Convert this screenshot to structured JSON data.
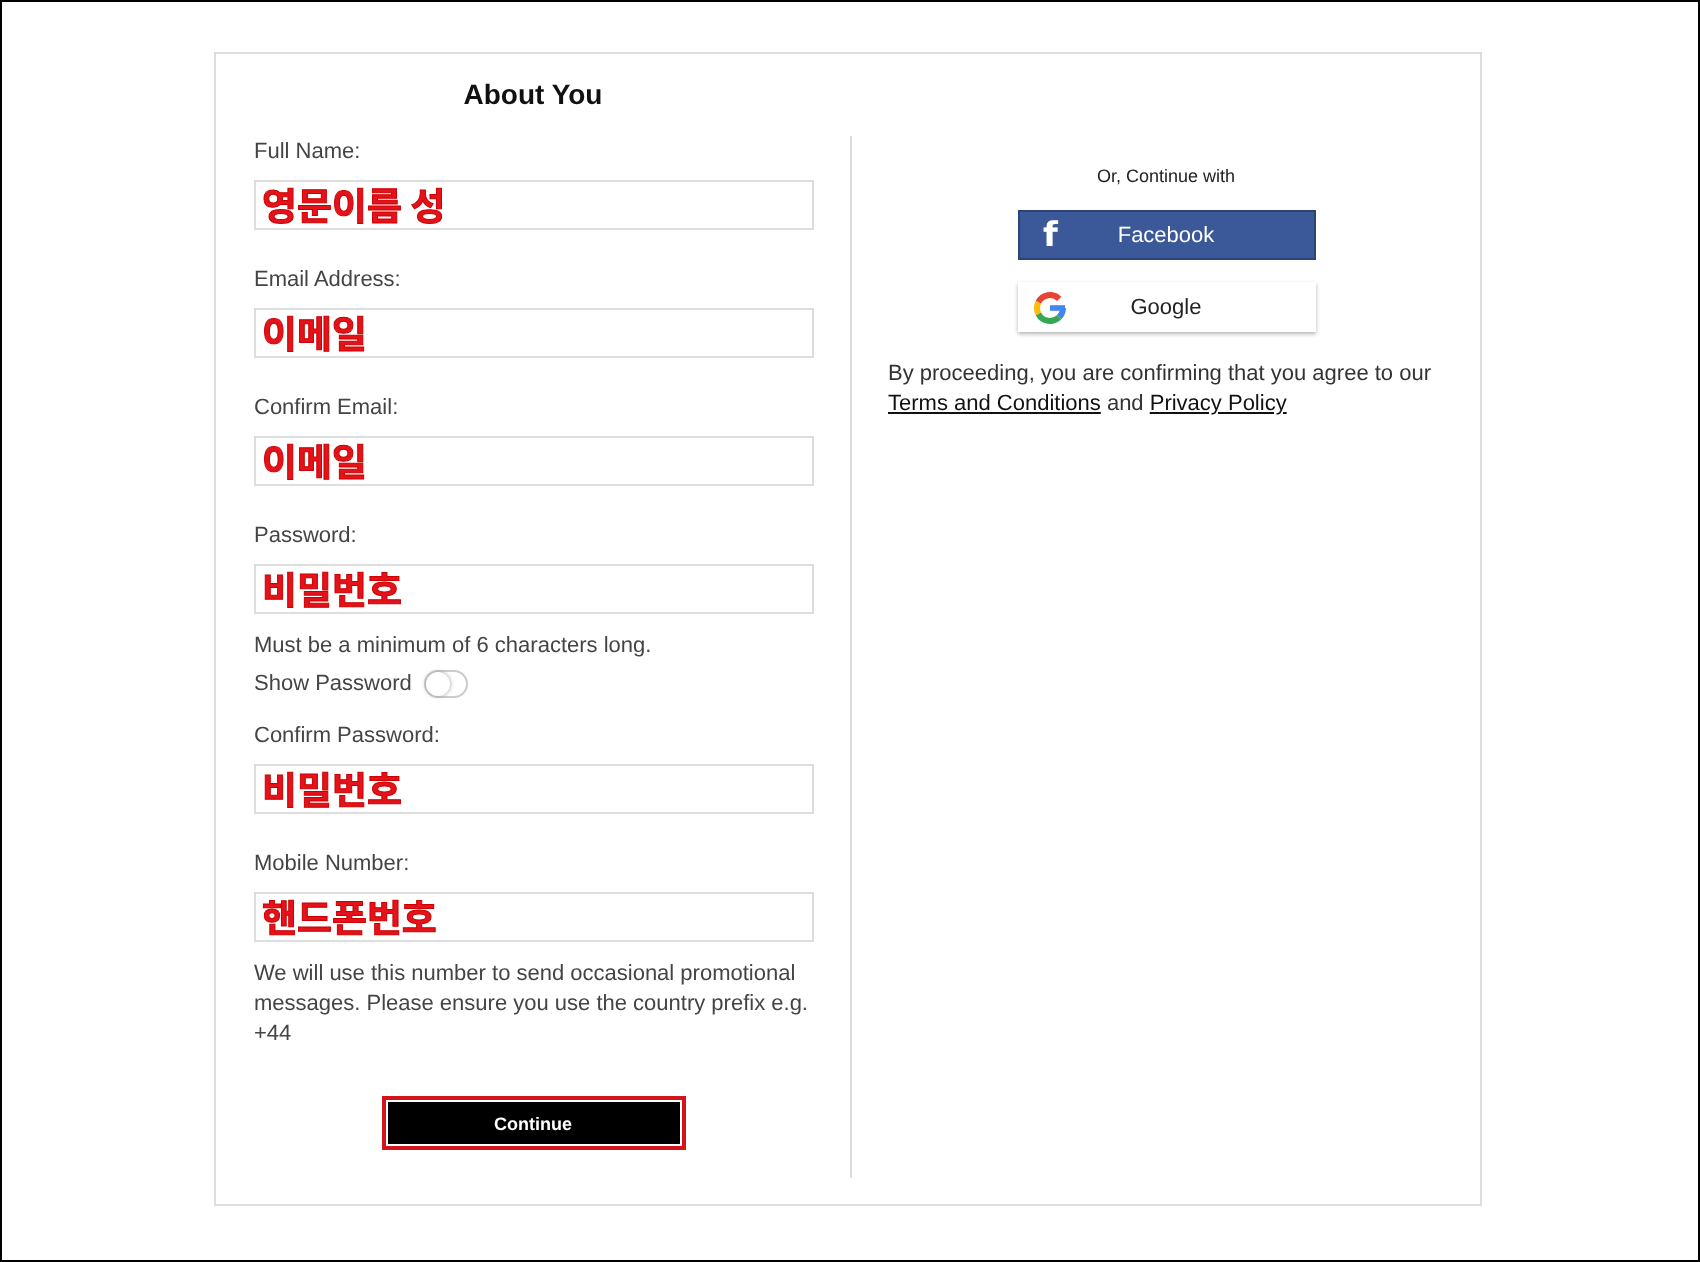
{
  "title": "About You",
  "fields": [
    {
      "label": "Full Name:",
      "value": "영문이름 성"
    },
    {
      "label": "Email Address:",
      "value": "이메일"
    },
    {
      "label": "Confirm Email:",
      "value": "이메일"
    },
    {
      "label": "Password:",
      "value": "비밀번호",
      "hint": "Must be a minimum of 6 characters long.",
      "toggle": {
        "label": "Show Password",
        "on": false
      }
    },
    {
      "label": "Confirm Password:",
      "value": "비밀번호"
    },
    {
      "label": "Mobile Number:",
      "value": "핸드폰번호",
      "hint": "We will use this number to send occasional promotional messages. Please ensure you use the country prefix e.g. +44"
    }
  ],
  "submit": {
    "label": "Continue",
    "highlighted": true
  },
  "social": {
    "heading": "Or, Continue with",
    "buttons": [
      {
        "kind": "facebook",
        "label": "Facebook",
        "icon": "f"
      },
      {
        "kind": "google",
        "label": "Google"
      }
    ]
  },
  "legal": {
    "text": "By proceeding, you are confirming that you agree to our",
    "link1": "Terms and Conditions",
    "joiner": "and",
    "link2": "Privacy Policy"
  }
}
